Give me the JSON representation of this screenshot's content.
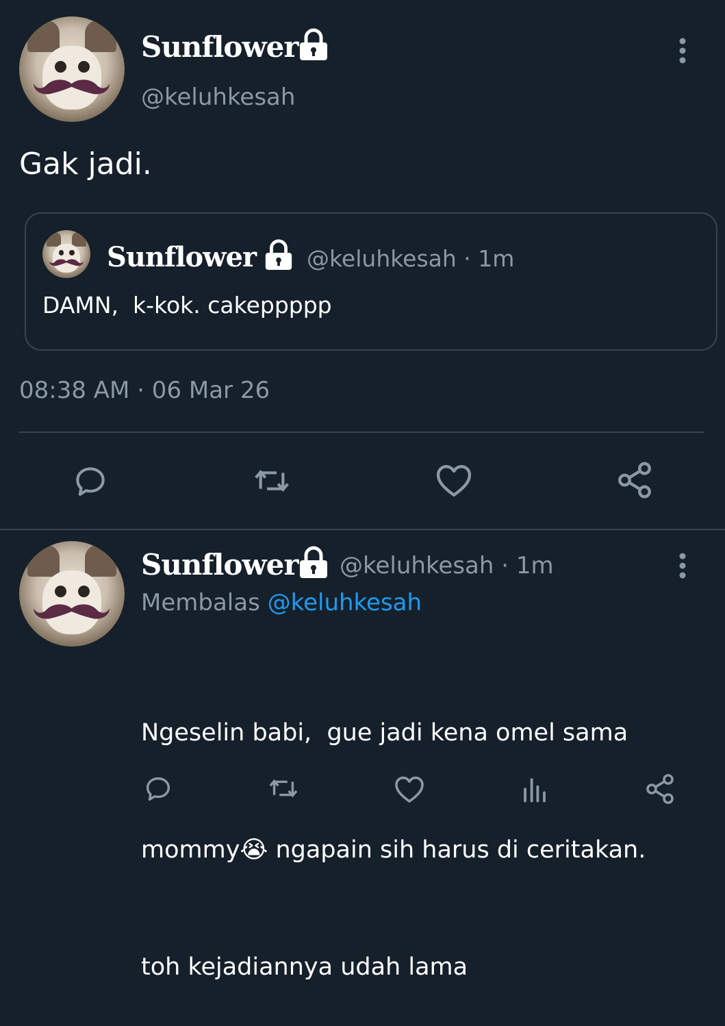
{
  "main_tweet": {
    "display_name": "Sunflower",
    "handle": "@keluhkesah",
    "text": "Gak jadi.",
    "quoted": {
      "display_name": "Sunflower",
      "handle_time": "@keluhkesah · 1m",
      "text": "DAMN,  k-kok. cakeppppp"
    },
    "timestamp": "08:38 AM · 06 Mar 26"
  },
  "reply_tweet": {
    "display_name": "Sunflower",
    "handle_time": "@keluhkesah · 1m",
    "replying_prefix": "Membalas",
    "replying_to": "@keluhkesah",
    "line1": "Ngeselin babi,  gue jadi kena omel sama",
    "line2_a": "mommy",
    "emoji": "😭",
    "line2_b": " ngapain sih harus di ceritakan.",
    "line3": "toh kejadiannya udah lama"
  },
  "colors": {
    "background": "#15202b",
    "muted": "#8b98a5",
    "link": "#1d9bf0",
    "divider": "#38444d"
  },
  "icons": [
    "lock-icon",
    "more-icon",
    "reply-icon",
    "retweet-icon",
    "like-icon",
    "share-icon",
    "analytics-icon"
  ]
}
